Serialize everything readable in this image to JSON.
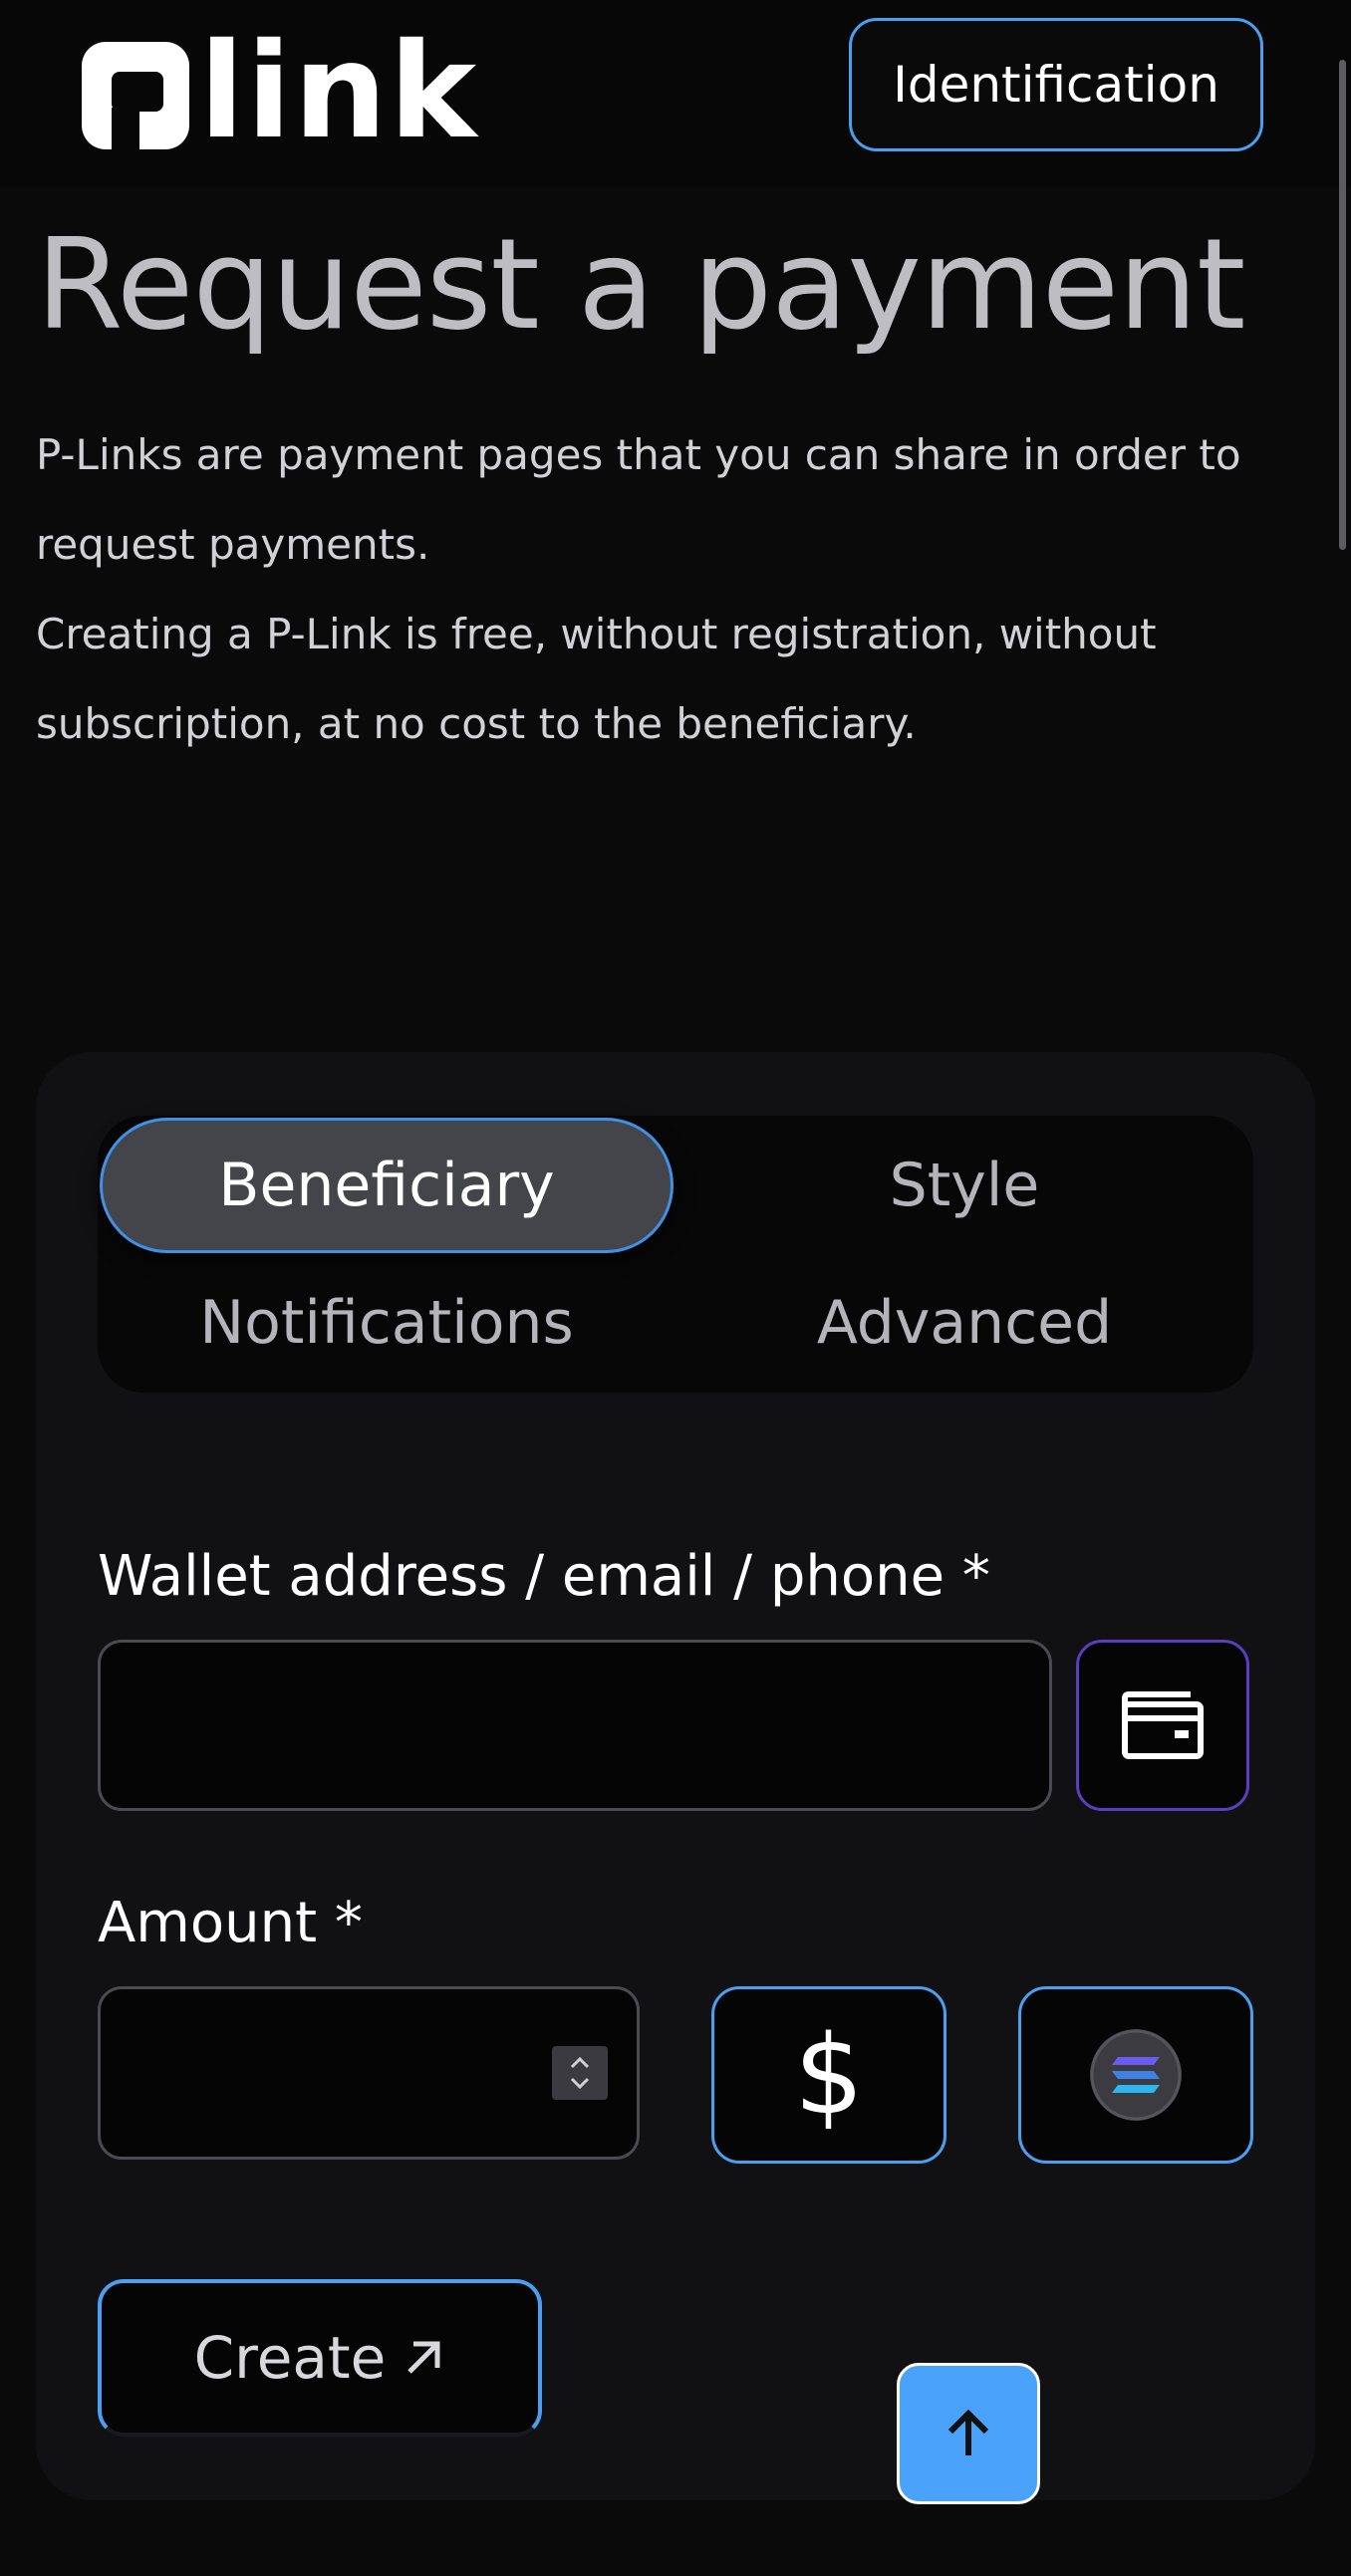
{
  "header": {
    "logo_text": "link",
    "identification_label": "Identification"
  },
  "hero": {
    "title": "Request a payment",
    "paragraph1": "P-Links are payment pages that you can share in order to request payments.",
    "paragraph2": "Creating a P-Link is free, without registration, without subscription, at no cost to the beneficiary."
  },
  "tabs": [
    {
      "label": "Beneficiary",
      "active": true
    },
    {
      "label": "Style",
      "active": false
    },
    {
      "label": "Notifications",
      "active": false
    },
    {
      "label": "Advanced",
      "active": false
    }
  ],
  "form": {
    "wallet_label": "Wallet address / email / phone *",
    "wallet_value": "",
    "amount_label": "Amount *",
    "amount_value": "",
    "currency_symbol": "$",
    "token_icon": "solana-icon",
    "create_label": "Create"
  },
  "colors": {
    "accent": "#4b9ff0",
    "wallet_border": "#5a3ec0",
    "scroll_top_bg": "#4ba2fb"
  }
}
